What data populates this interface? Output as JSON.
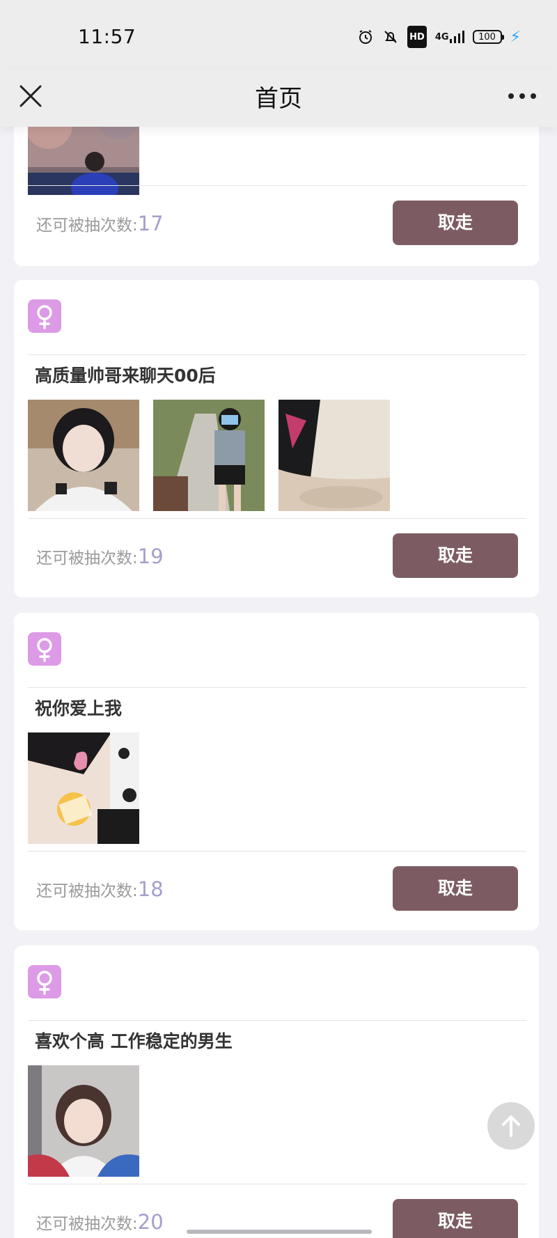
{
  "status_bar": {
    "time": "11:57",
    "network": "4G",
    "battery": "100",
    "icons": [
      "alarm-icon",
      "mute-bell-icon",
      "hd-icon",
      "signal-icon",
      "battery-icon",
      "charging-icon"
    ]
  },
  "nav": {
    "title": "首页",
    "close_icon": "close-icon",
    "more_icon": "more-dots-icon"
  },
  "card_common": {
    "count_label": "还可被抽次数:",
    "button_label": "取走",
    "gender_icon": "female-icon"
  },
  "cards": [
    {
      "title": "",
      "photo_count": 1,
      "count": "17"
    },
    {
      "title": "高质量帅哥来聊天00后",
      "photo_count": 3,
      "count": "19"
    },
    {
      "title": "祝你爱上我",
      "photo_count": 1,
      "count": "18"
    },
    {
      "title": "喜欢个高 工作稳定的男生",
      "photo_count": 1,
      "count": "20"
    }
  ],
  "colors": {
    "button": "#7c5c62",
    "count_value": "#a3a0cc",
    "gender_badge": "#dd9ae6",
    "background": "#f2f2f6"
  }
}
